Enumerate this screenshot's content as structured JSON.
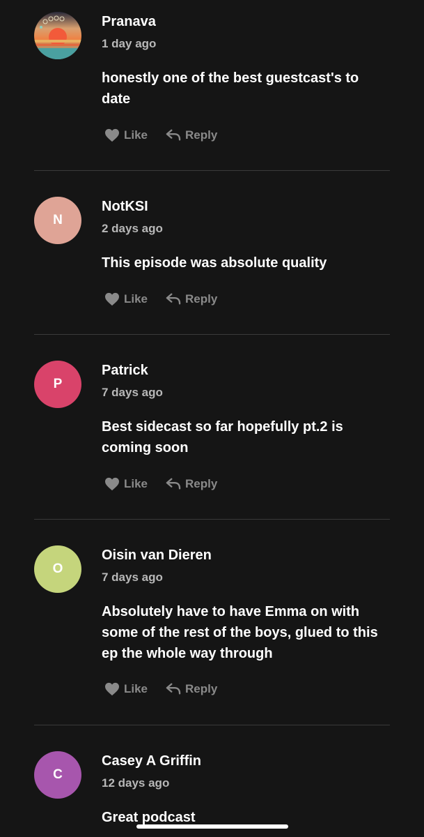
{
  "actions": {
    "like_label": "Like",
    "reply_label": "Reply"
  },
  "comments": [
    {
      "name": "Pranava",
      "time": "1 day ago",
      "text": "honestly one of the best guestcast's to date",
      "avatar_type": "image",
      "avatar_letter": "",
      "avatar_color": "#e58a4a"
    },
    {
      "name": "NotKSI",
      "time": "2 days ago",
      "text": "This episode was absolute quality",
      "avatar_type": "letter",
      "avatar_letter": "N",
      "avatar_color": "#dfa496"
    },
    {
      "name": "Patrick",
      "time": "7 days ago",
      "text": "Best sidecast so far hopefully pt.2 is coming soon",
      "avatar_type": "letter",
      "avatar_letter": "P",
      "avatar_color": "#d9436a"
    },
    {
      "name": "Oisin van Dieren",
      "time": "7 days ago",
      "text": "Absolutely have to have Emma on with some of the rest of the boys, glued to this ep the whole way through",
      "avatar_type": "letter",
      "avatar_letter": "O",
      "avatar_color": "#c5d57c"
    },
    {
      "name": "Casey A Griffin",
      "time": "12 days ago",
      "text": "Great podcast",
      "avatar_type": "letter",
      "avatar_letter": "C",
      "avatar_color": "#a756ad"
    }
  ],
  "icons": {
    "like": "heart-icon",
    "reply": "reply-arrow-icon"
  },
  "colors": {
    "background": "#151515",
    "muted": "#8a8a8a",
    "secondary": "#b8b8b8",
    "divider": "#3a3a3a"
  }
}
